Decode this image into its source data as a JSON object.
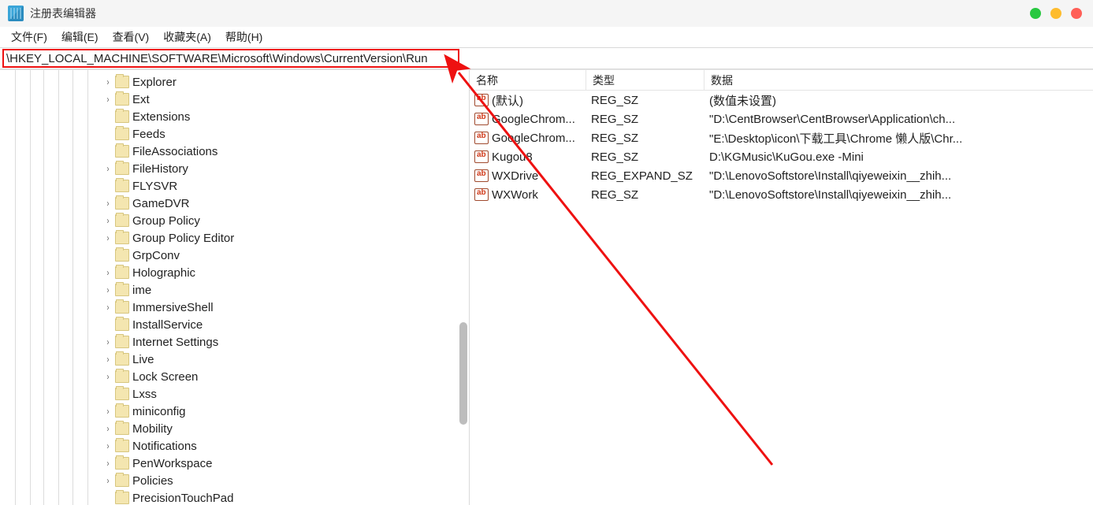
{
  "window": {
    "title": "注册表编辑器"
  },
  "menubar": {
    "file": "文件(F)",
    "edit": "编辑(E)",
    "view": "查看(V)",
    "favorites": "收藏夹(A)",
    "help": "帮助(H)"
  },
  "addressbar": {
    "value": "\\HKEY_LOCAL_MACHINE\\SOFTWARE\\Microsoft\\Windows\\CurrentVersion\\Run"
  },
  "tree": {
    "items": [
      {
        "label": "Explorer",
        "expandable": true
      },
      {
        "label": "Ext",
        "expandable": true
      },
      {
        "label": "Extensions",
        "expandable": false
      },
      {
        "label": "Feeds",
        "expandable": false
      },
      {
        "label": "FileAssociations",
        "expandable": false
      },
      {
        "label": "FileHistory",
        "expandable": true
      },
      {
        "label": "FLYSVR",
        "expandable": false
      },
      {
        "label": "GameDVR",
        "expandable": true
      },
      {
        "label": "Group Policy",
        "expandable": true
      },
      {
        "label": "Group Policy Editor",
        "expandable": true
      },
      {
        "label": "GrpConv",
        "expandable": false
      },
      {
        "label": "Holographic",
        "expandable": true
      },
      {
        "label": "ime",
        "expandable": true
      },
      {
        "label": "ImmersiveShell",
        "expandable": true
      },
      {
        "label": "InstallService",
        "expandable": false
      },
      {
        "label": "Internet Settings",
        "expandable": true
      },
      {
        "label": "Live",
        "expandable": true
      },
      {
        "label": "Lock Screen",
        "expandable": true
      },
      {
        "label": "Lxss",
        "expandable": false
      },
      {
        "label": "miniconfig",
        "expandable": true
      },
      {
        "label": "Mobility",
        "expandable": true
      },
      {
        "label": "Notifications",
        "expandable": true
      },
      {
        "label": "PenWorkspace",
        "expandable": true
      },
      {
        "label": "Policies",
        "expandable": true
      },
      {
        "label": "PrecisionTouchPad",
        "expandable": false
      }
    ]
  },
  "values": {
    "columns": {
      "name": "名称",
      "type": "类型",
      "data": "数据"
    },
    "rows": [
      {
        "name": "(默认)",
        "type": "REG_SZ",
        "data": "(数值未设置)"
      },
      {
        "name": "GoogleChrom...",
        "type": "REG_SZ",
        "data": "\"D:\\CentBrowser\\CentBrowser\\Application\\ch..."
      },
      {
        "name": "GoogleChrom...",
        "type": "REG_SZ",
        "data": "\"E:\\Desktop\\icon\\下载工具\\Chrome 懒人版\\Chr..."
      },
      {
        "name": "Kugou8",
        "type": "REG_SZ",
        "data": "D:\\KGMusic\\KuGou.exe -Mini"
      },
      {
        "name": "WXDrive",
        "type": "REG_EXPAND_SZ",
        "data": "\"D:\\LenovoSoftstore\\Install\\qiyeweixin__zhih..."
      },
      {
        "name": "WXWork",
        "type": "REG_SZ",
        "data": "\"D:\\LenovoSoftstore\\Install\\qiyeweixin__zhih..."
      }
    ]
  }
}
